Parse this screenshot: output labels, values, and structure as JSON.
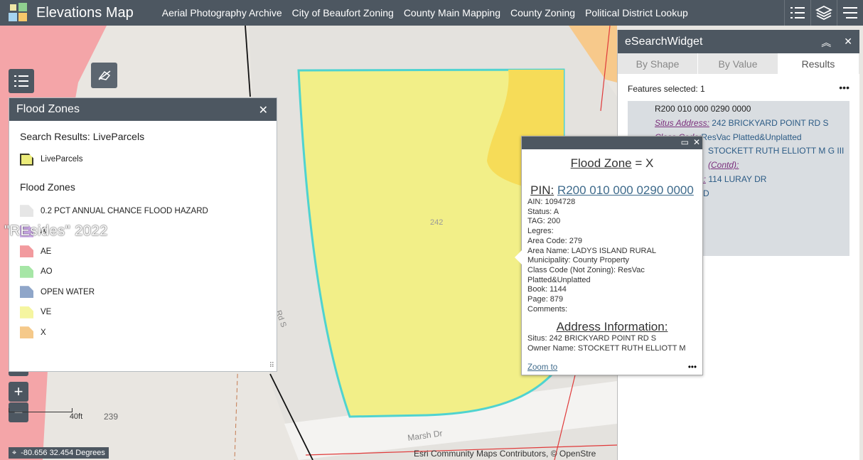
{
  "app": {
    "title": "Elevations Map",
    "nav": [
      "Aerial Photography Archive",
      "City of Beaufort Zoning",
      "County Main Mapping",
      "County Zoning",
      "Political District Lookup"
    ],
    "icons": [
      "list-icon",
      "layers-icon",
      "menu-icon"
    ]
  },
  "map": {
    "parcel_label": "242",
    "street_labels": [
      "Marsh Dr",
      "Rd S"
    ],
    "lot_label": "239",
    "scale_label": "40ft",
    "coords": "-80.656 32.454 Degrees",
    "attribution": "Esri Community Maps Contributors, © OpenStre"
  },
  "flood_panel": {
    "title": "Flood Zones",
    "search_results": "Search Results: LiveParcels",
    "parcel_layer": "LiveParcels",
    "section": "Flood Zones",
    "legend": [
      {
        "label": "0.2 PCT ANNUAL CHANCE FLOOD HAZARD",
        "color": "#e6e6e6"
      },
      {
        "label": "A",
        "color": "#c9a6e6"
      },
      {
        "label": "AE",
        "color": "#f29a9e"
      },
      {
        "label": "AO",
        "color": "#a6e6a6"
      },
      {
        "label": "OPEN WATER",
        "color": "#8fa6c9"
      },
      {
        "label": "VE",
        "color": "#f5f5a0"
      },
      {
        "label": "X",
        "color": "#f5c98a"
      }
    ]
  },
  "watermark": "\"REsides\" 2022",
  "popup": {
    "title_label": "Flood Zone",
    "title_value": "= X",
    "pin_label": "PIN:",
    "pin_value": "R200 010 000 0290 0000",
    "fields": [
      "AIN: 1094728",
      "Status: A",
      "TAG: 200",
      "Legres:",
      "Area Code: 279",
      "Area Name: LADYS ISLAND RURAL",
      "Municipality: County Property",
      "Class Code (Not Zoning): ResVac Platted&Unplatted",
      "Book: 1144",
      "Page: 879",
      "Comments:"
    ],
    "address_title": "Address Information:",
    "address_fields": [
      "Situs: 242 BRICKYARD POINT RD S",
      "Owner Name: STOCKETT RUTH ELLIOTT M"
    ],
    "zoom_link": "Zoom to",
    "more": "•••"
  },
  "esearch": {
    "title": "eSearchWidget",
    "tabs": [
      "By Shape",
      "By Value",
      "Results"
    ],
    "active_tab": "Results",
    "features_selected": "Features selected: 1",
    "more": "•••",
    "result": {
      "pin": "R200 010 000 0290 0000",
      "situs_label": "Situs Address:",
      "situs_value": "242 BRICKYARD POINT RD S",
      "class_label": "Class Code:",
      "class_value": "ResVac Platted&Unplatted",
      "owner_value": "STOCKETT RUTH ELLIOTT M G III",
      "owner_contd": "(Contd):",
      "mail_label": "ess:",
      "mail_value": "114 LURAY DR",
      "city_value": "OND"
    }
  }
}
